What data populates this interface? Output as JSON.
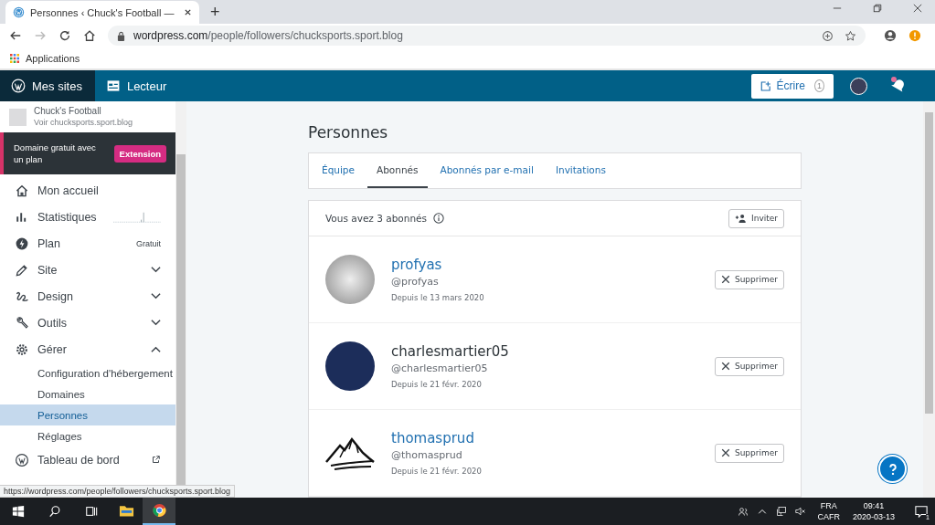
{
  "browser": {
    "tab_title": "Personnes ‹ Chuck's Football —",
    "new_tab": "+",
    "url_host": "wordpress.com",
    "url_path": "/people/followers/chucksports.sport.blog",
    "bookmark": "Applications",
    "status_url": "https://wordpress.com/people/followers/chucksports.sport.blog"
  },
  "masterbar": {
    "items": [
      {
        "label": "Mes sites",
        "selected": true
      },
      {
        "label": "Lecteur",
        "selected": false
      }
    ],
    "write_label": "Écrire",
    "write_count": "1",
    "notifications_unread": true
  },
  "sidebar": {
    "site_name": "Chuck's Football",
    "site_url": "Voir chucksports.sport.blog",
    "banner_text": "Domaine gratuit avec un plan",
    "banner_button": "Extension",
    "items": [
      {
        "kind": "link",
        "label": "Mon accueil"
      },
      {
        "kind": "stats",
        "label": "Statistiques"
      },
      {
        "kind": "badge",
        "label": "Plan",
        "badge": "Gratuit"
      },
      {
        "kind": "expandable",
        "label": "Site",
        "expanded": false
      },
      {
        "kind": "expandable",
        "label": "Design",
        "expanded": false
      },
      {
        "kind": "expandable",
        "label": "Outils",
        "expanded": false
      },
      {
        "kind": "expandable",
        "label": "Gérer",
        "expanded": true,
        "children": [
          {
            "label": "Configuration d'hébergement",
            "selected": false
          },
          {
            "label": "Domaines",
            "selected": false
          },
          {
            "label": "Personnes",
            "selected": true
          },
          {
            "label": "Réglages",
            "selected": false
          }
        ]
      },
      {
        "kind": "external",
        "label": "Tableau de bord"
      }
    ]
  },
  "page": {
    "title": "Personnes",
    "tabs": [
      {
        "label": "Équipe",
        "selected": false
      },
      {
        "label": "Abonnés",
        "selected": true
      },
      {
        "label": "Abonnés par e-mail",
        "selected": false
      },
      {
        "label": "Invitations",
        "selected": false
      }
    ],
    "count_text": "Vous avez 3 abonnés",
    "invite_button": "Inviter",
    "followers": [
      {
        "name": "profyas",
        "linked": true,
        "handle": "@profyas",
        "since": "Depuis le 13 mars 2020",
        "kind": "photo",
        "remove": "Supprimer"
      },
      {
        "name": "charlesmartier05",
        "linked": false,
        "handle": "@charlesmartier05",
        "since": "Depuis le 21 févr. 2020",
        "kind": "photo",
        "remove": "Supprimer"
      },
      {
        "name": "thomasprud",
        "linked": true,
        "handle": "@thomasprud",
        "since": "Depuis le 21 févr. 2020",
        "kind": "logo",
        "remove": "Supprimer"
      }
    ]
  },
  "taskbar": {
    "language": "FRA",
    "layout": "CAFR",
    "time": "09:41",
    "date": "2020-03-13",
    "notification_count": "1"
  }
}
